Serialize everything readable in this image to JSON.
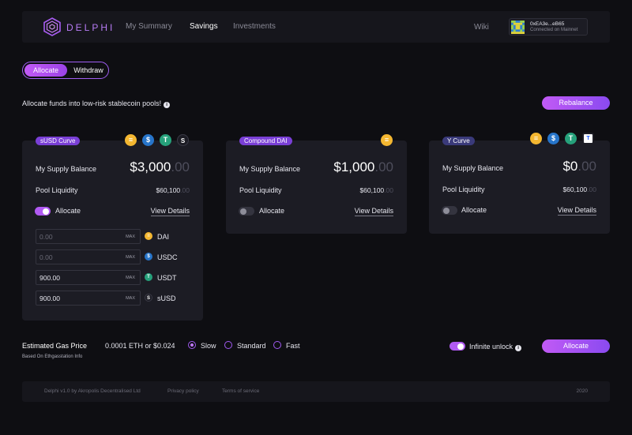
{
  "header": {
    "brand": "DELPHI",
    "nav": [
      "My Summary",
      "Savings",
      "Investments"
    ],
    "active_nav": "Savings",
    "wiki": "Wiki",
    "account": {
      "address": "0xEA3e...eB65",
      "network": "Connected on Mainnet"
    }
  },
  "mode": {
    "allocate": "Allocate",
    "withdraw": "Withdraw"
  },
  "intro": "Allocate funds into low-risk stablecoin pools!",
  "rebalance": "Rebalance",
  "pools": [
    {
      "name": "sUSD Curve",
      "tokens": [
        "DAI",
        "USDC",
        "USDT",
        "sUSD"
      ],
      "supply_label": "My Supply Balance",
      "supply_main": "$3,000",
      "supply_dec": ".00",
      "liquidity_label": "Pool Liquidity",
      "liquidity_main": "$60,100",
      "liquidity_dec": ".00",
      "allocate_label": "Allocate",
      "allocate_on": true,
      "details": "View Details",
      "inputs": [
        {
          "value": "0.00",
          "token": "DAI",
          "max": "MAX"
        },
        {
          "value": "0.00",
          "token": "USDC",
          "max": "MAX"
        },
        {
          "value": "900.00",
          "token": "USDT",
          "max": "MAX"
        },
        {
          "value": "900.00",
          "token": "sUSD",
          "max": "MAX"
        }
      ]
    },
    {
      "name": "Compound DAI",
      "tokens": [
        "DAI"
      ],
      "supply_label": "My Supply Balance",
      "supply_main": "$1,000",
      "supply_dec": ".00",
      "liquidity_label": "Pool Liquidity",
      "liquidity_main": "$60,100",
      "liquidity_dec": ".00",
      "allocate_label": "Allocate",
      "allocate_on": false,
      "details": "View Details"
    },
    {
      "name": "Y Curve",
      "tokens": [
        "DAI",
        "USDC",
        "USDT",
        "TUSD"
      ],
      "supply_label": "My Supply Balance",
      "supply_main": "$0",
      "supply_dec": ".00",
      "liquidity_label": "Pool Liquidity",
      "liquidity_main": "$60,100",
      "liquidity_dec": ".00",
      "allocate_label": "Allocate",
      "allocate_on": false,
      "details": "View Details"
    }
  ],
  "gas": {
    "title": "Estimated Gas Price",
    "subtitle": "Based On Ethgasstation Info",
    "value": "0.0001 ETH or $0.024",
    "options": [
      "Slow",
      "Standard",
      "Fast"
    ],
    "selected": "Slow"
  },
  "infinite_unlock": {
    "label": "Infinite unlock",
    "on": true
  },
  "allocate_button": "Allocate",
  "footer": {
    "credit": "Delphi v1.0 by Akropolis Decentralised Ltd",
    "privacy": "Privacy policy",
    "terms": "Terms of service",
    "year": "2020"
  },
  "colors": {
    "accent": "#b15af3",
    "dai": "#f4b731",
    "usdc": "#2775ca",
    "usdt": "#26a17b",
    "tusd": "#1a5aff",
    "pool_pill_1": "#7a3fd6",
    "pool_pill_2": "#7a3fd6",
    "pool_pill_3": "#3a3a7a"
  }
}
